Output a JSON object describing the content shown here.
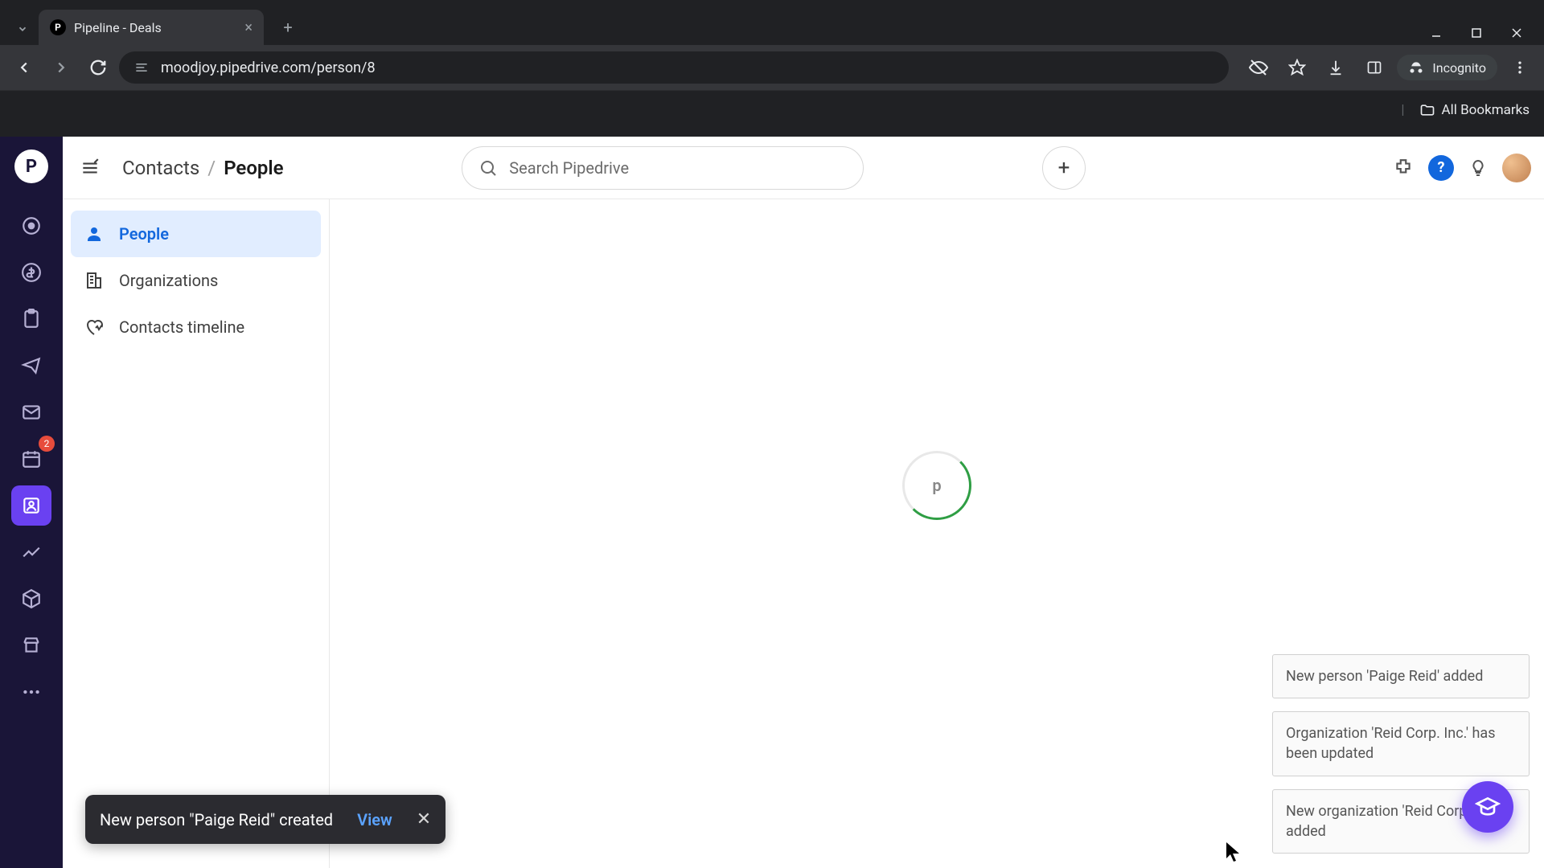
{
  "browser": {
    "tab_title": "Pipeline - Deals",
    "url": "moodjoy.pipedrive.com/person/8",
    "incognito_label": "Incognito",
    "bookmarks_label": "All Bookmarks"
  },
  "header": {
    "breadcrumb_root": "Contacts",
    "breadcrumb_sep": "/",
    "breadcrumb_current": "People",
    "search_placeholder": "Search Pipedrive",
    "help_symbol": "?"
  },
  "rail": {
    "logo_letter": "P",
    "badge_count": "2"
  },
  "sidebar": {
    "items": [
      {
        "label": "People",
        "icon": "person",
        "active": true
      },
      {
        "label": "Organizations",
        "icon": "building",
        "active": false
      },
      {
        "label": "Contacts timeline",
        "icon": "heart-timeline",
        "active": false
      }
    ]
  },
  "spinner": {
    "letter": "p"
  },
  "snackbar": {
    "message": "New person \"Paige Reid\" created",
    "action": "View"
  },
  "notifications": [
    {
      "text": "New person 'Paige Reid' added"
    },
    {
      "text": "Organization 'Reid Corp. Inc.' has been updated"
    },
    {
      "text": "New organization 'Reid Corp.' added"
    }
  ]
}
